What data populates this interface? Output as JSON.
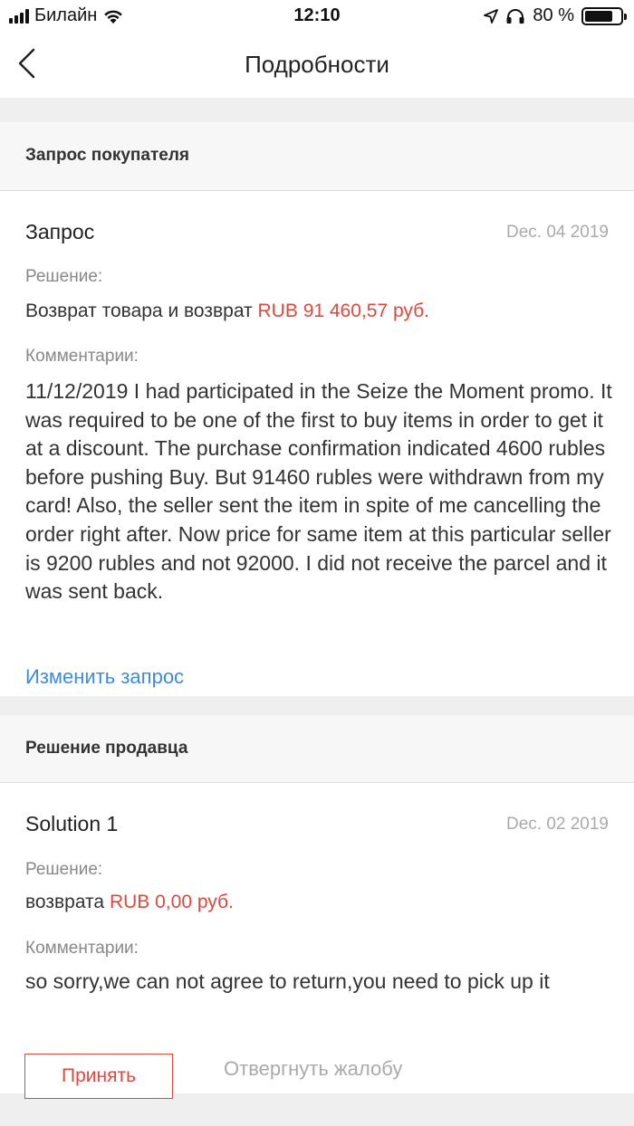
{
  "status_bar": {
    "carrier": "Билайн",
    "time": "12:10",
    "battery_percent_text": "80 %",
    "battery_level": 0.8
  },
  "nav": {
    "title": "Подробности"
  },
  "buyer_section": {
    "header": "Запрос покупателя",
    "title": "Запрос",
    "date": "Dec. 04 2019",
    "decision_label": "Решение:",
    "decision_text": "Возврат товара и возврат",
    "decision_amount": "RUB 91 460,57 руб.",
    "comments_label": "Комментарии:",
    "comment": "11/12/2019 I had participated in the Seize the Moment promo. It was required to be one of the first to buy items in order to get it at a discount. The purchase confirmation indicated 4600 rubles before pushing Buy. But 91460 rubles were withdrawn from my card! Also, the seller sent the item in spite of me cancelling the order right after. Now price for same item at this particular seller is 9200 rubles and not 92000. I did not receive the parcel and it was sent back.",
    "edit_link": "Изменить запрос"
  },
  "seller_section": {
    "header": "Решение продавца",
    "title": "Solution 1",
    "date": "Dec. 02 2019",
    "decision_label": "Решение:",
    "decision_text": "возврата",
    "decision_amount": "RUB 0,00 руб.",
    "comments_label": "Комментарии:",
    "comment": "so sorry,we can not agree to return,you need to pick up it"
  },
  "actions": {
    "accept": "Принять",
    "reject": "Отвергнуть жалобу"
  },
  "colors": {
    "accent_red": "#e0483d",
    "link_blue": "#3f8ae0",
    "muted": "#aaaaaa"
  }
}
